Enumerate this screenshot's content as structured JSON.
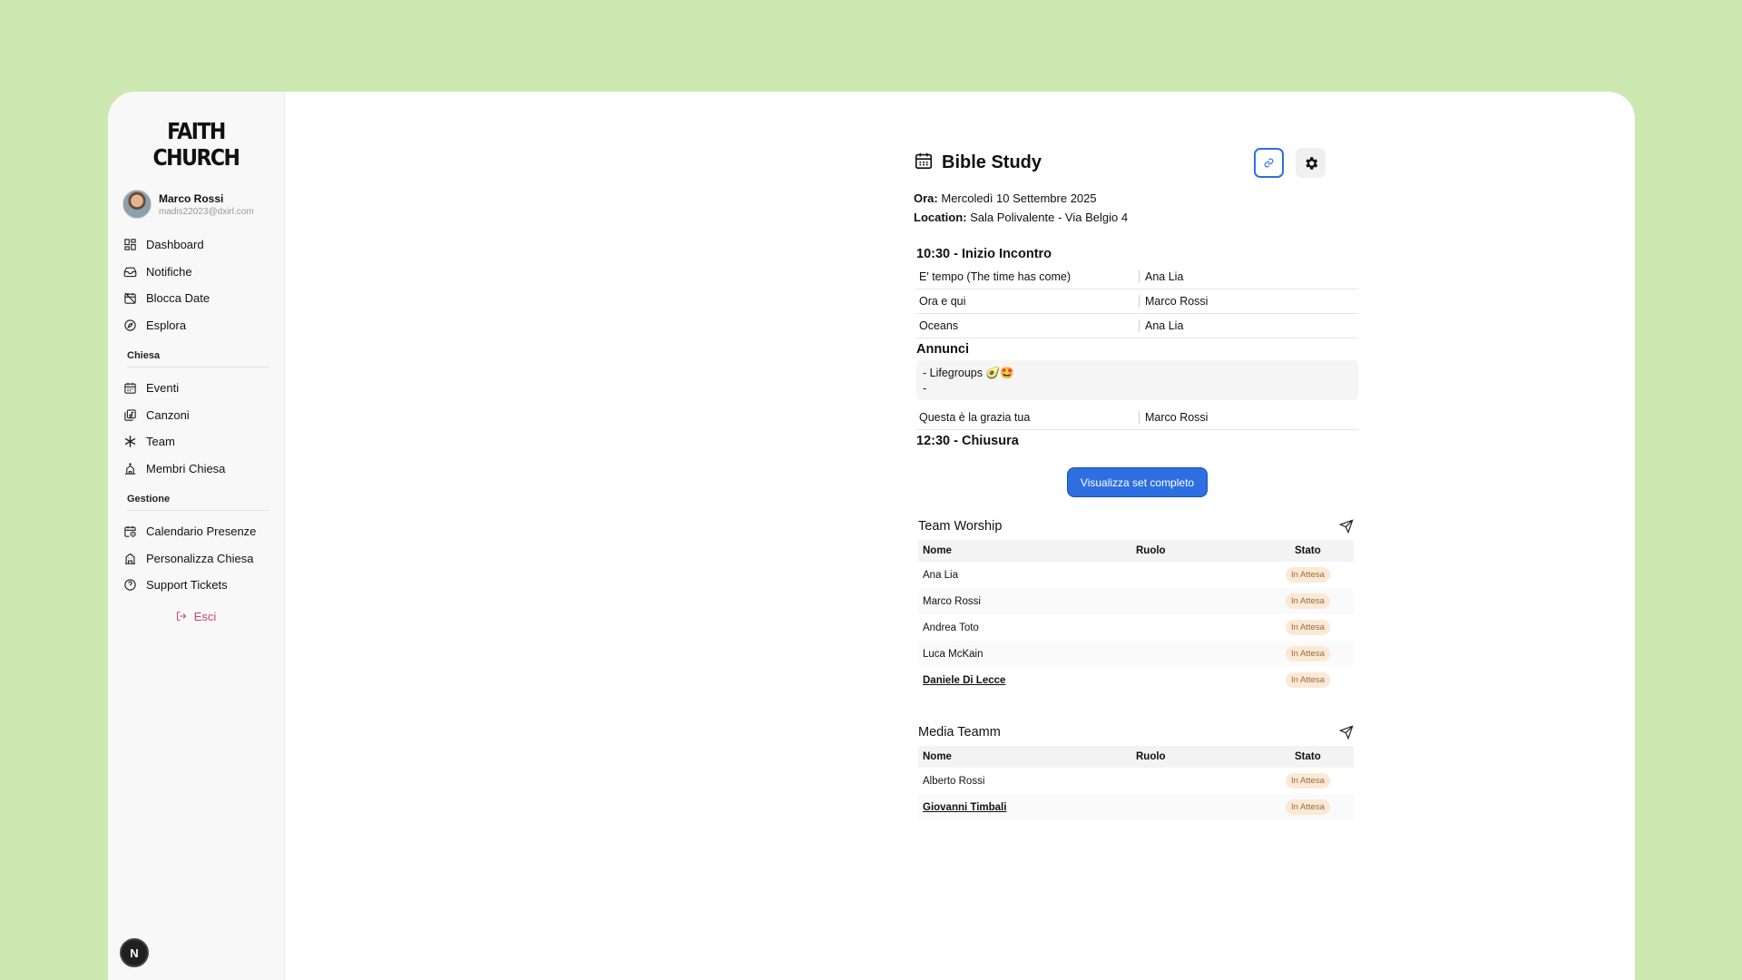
{
  "sidebar": {
    "logo": "FAITH CHURCH",
    "user": {
      "name": "Marco Rossi",
      "email": "madis22023@dxirl.com"
    },
    "main_items": [
      {
        "label": "Dashboard",
        "icon": "dashboard-icon"
      },
      {
        "label": "Notifiche",
        "icon": "inbox-icon"
      },
      {
        "label": "Blocca Date",
        "icon": "calendar-off-icon"
      },
      {
        "label": "Esplora",
        "icon": "compass-icon"
      }
    ],
    "section_chiesa": "Chiesa",
    "chiesa_items": [
      {
        "label": "Eventi",
        "icon": "calendar-icon"
      },
      {
        "label": "Canzoni",
        "icon": "music-library-icon"
      },
      {
        "label": "Team",
        "icon": "asterisk-icon"
      },
      {
        "label": "Membri Chiesa",
        "icon": "church-icon"
      }
    ],
    "section_gestione": "Gestione",
    "gestione_items": [
      {
        "label": "Calendario Presenze",
        "icon": "calendar-clock-icon"
      },
      {
        "label": "Personalizza Chiesa",
        "icon": "building-icon"
      },
      {
        "label": "Support Tickets",
        "icon": "help-circle-icon"
      }
    ],
    "logout": "Esci",
    "fab_letter": "N"
  },
  "event": {
    "title": "Bible Study",
    "ora_label": "Ora:",
    "ora_value": "Mercoledì 10 Settembre 2025",
    "location_label": "Location:",
    "location_value": "Sala Polivalente - Via Belgio 4"
  },
  "schedule": {
    "start_heading": "10:30 - Inizio Incontro",
    "songs": [
      {
        "song": "E' tempo (The time has come)",
        "leader": "Ana Lia"
      },
      {
        "song": "Ora e qui",
        "leader": "Marco Rossi"
      },
      {
        "song": "Oceans",
        "leader": "Ana Lia"
      }
    ],
    "annunci_heading": "Annunci",
    "annunci_line1": "- Lifegroups 🥑🤩",
    "annunci_line2": "-",
    "after_song": {
      "song": "Questa è la grazia tua",
      "leader": "Marco Rossi"
    },
    "end_heading": "12:30 - Chiusura"
  },
  "view_full_set": "Visualizza set completo",
  "team_worship": {
    "title": "Team Worship",
    "columns": {
      "nome": "Nome",
      "ruolo": "Ruolo",
      "stato": "Stato"
    },
    "rows": [
      {
        "nome": "Ana Lia",
        "ruolo": "",
        "stato": "In Attesa",
        "link": false
      },
      {
        "nome": "Marco Rossi",
        "ruolo": "",
        "stato": "In Attesa",
        "link": false
      },
      {
        "nome": "Andrea Toto",
        "ruolo": "",
        "stato": "In Attesa",
        "link": false
      },
      {
        "nome": "Luca McKain",
        "ruolo": "",
        "stato": "In Attesa",
        "link": false
      },
      {
        "nome": "Daniele Di Lecce",
        "ruolo": "",
        "stato": "In Attesa",
        "link": true
      }
    ]
  },
  "media_team": {
    "title": "Media Teamm",
    "columns": {
      "nome": "Nome",
      "ruolo": "Ruolo",
      "stato": "Stato"
    },
    "rows": [
      {
        "nome": "Alberto Rossi",
        "ruolo": "",
        "stato": "In Attesa",
        "link": false
      },
      {
        "nome": "Giovanni Timbali",
        "ruolo": "",
        "stato": "In Attesa",
        "link": true
      }
    ]
  },
  "colors": {
    "accent": "#2d6fe0",
    "background": "#cce8b0",
    "logout": "#d0455f",
    "badge_bg": "#fbe9d6",
    "badge_text": "#9a6a3a"
  }
}
